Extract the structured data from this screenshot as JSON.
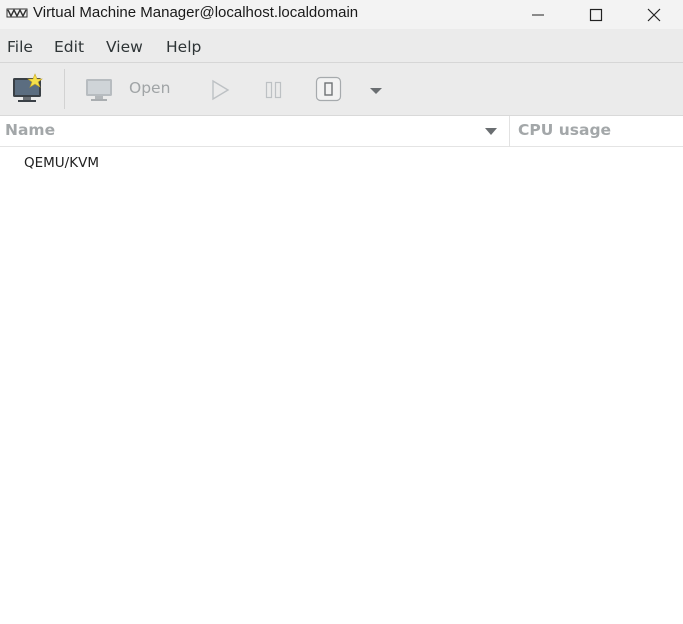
{
  "window": {
    "title": "Virtual Machine Manager@localhost.localdomain"
  },
  "menubar": {
    "items": [
      {
        "label": "File"
      },
      {
        "label": "Edit"
      },
      {
        "label": "View"
      },
      {
        "label": "Help"
      }
    ]
  },
  "toolbar": {
    "new_vm_icon": "new-vm-icon",
    "open_icon": "monitor-icon",
    "open_label": "Open",
    "run_icon": "play-icon",
    "pause_icon": "pause-icon",
    "shutdown_icon": "power-icon",
    "menu_icon": "chevron-down-icon",
    "disabled_color": "#a0a4a6"
  },
  "list": {
    "columns": [
      {
        "label": "Name"
      },
      {
        "label": "CPU usage"
      }
    ],
    "rows": [
      {
        "name": "QEMU/KVM"
      }
    ]
  }
}
